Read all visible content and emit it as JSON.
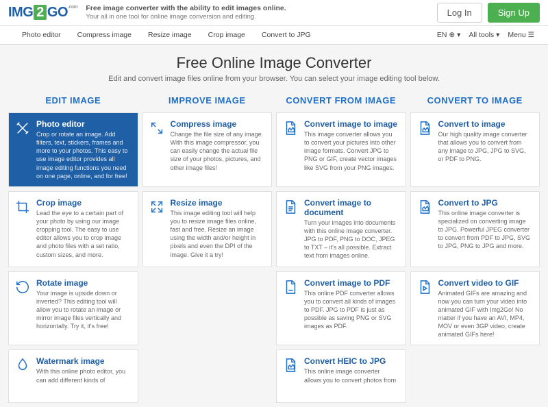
{
  "header": {
    "logo": {
      "img": "IMG",
      "two": "2",
      "go": "GO",
      "com": ".com"
    },
    "tagline_main": "Free image converter with the ability to edit images online.",
    "tagline_sub": "Your all in one tool for online image conversion and editing.",
    "login": "Log In",
    "signup": "Sign Up"
  },
  "nav": {
    "items": [
      "Photo editor",
      "Compress image",
      "Resize image",
      "Crop image",
      "Convert to JPG"
    ],
    "lang": "EN",
    "alltools": "All tools",
    "menu": "Menu"
  },
  "hero": {
    "title": "Free Online Image Converter",
    "subtitle": "Edit and convert image files online from your browser. You can select your image editing tool below."
  },
  "columns": [
    {
      "header": "EDIT IMAGE",
      "cards": [
        {
          "icon": "crossed-tools",
          "title": "Photo editor",
          "desc": "Crop or rotate an image. Add filters, text, stickers, frames and more to your photos. This easy to use image editor provides all image editing functions you need on one page, online, and for free!",
          "active": true
        },
        {
          "icon": "crop",
          "title": "Crop image",
          "desc": "Lead the eye to a certain part of your photo by using our image cropping tool. The easy to use editor allows you to crop image and photo files with a set ratio, custom sizes, and more."
        },
        {
          "icon": "rotate",
          "title": "Rotate image",
          "desc": "Your image is upside down or inverted? This editing tool will allow you to rotate an image or mirror image files vertically and horizontally. Try it, it's free!"
        },
        {
          "icon": "watermark",
          "title": "Watermark image",
          "desc": "With this online photo editor, you can add different kinds of"
        }
      ]
    },
    {
      "header": "IMPROVE IMAGE",
      "cards": [
        {
          "icon": "compress",
          "title": "Compress image",
          "desc": "Change the file size of any image. With this image compressor, you can easily change the actual file size of your photos, pictures, and other image files!"
        },
        {
          "icon": "resize",
          "title": "Resize image",
          "desc": "This image editing tool will help you to resize image files online, fast and free. Resize an image using the width and/or height in pixels and even the DPI of the image. Give it a try!"
        }
      ]
    },
    {
      "header": "CONVERT FROM IMAGE",
      "cards": [
        {
          "icon": "file-img",
          "title": "Convert image to image",
          "desc": "This image converter allows you to convert your pictures into other image formats. Convert JPG to PNG or GIF, create vector images like SVG from your PNG images."
        },
        {
          "icon": "file-doc",
          "title": "Convert image to document",
          "desc": "Turn your images into documents with this online image converter. JPG to PDF, PNG to DOC, JPEG to TXT – it's all possible. Extract text from images online."
        },
        {
          "icon": "file-pdf",
          "title": "Convert image to PDF",
          "desc": "This online PDF converter allows you to convert all kinds of images to PDF. JPG to PDF is just as possible as saving PNG or SVG images as PDF."
        },
        {
          "icon": "file-img",
          "title": "Convert HEIC to JPG",
          "desc": "This online image converter allows you to convert photos from"
        }
      ]
    },
    {
      "header": "CONVERT TO IMAGE",
      "cards": [
        {
          "icon": "file-img",
          "title": "Convert to image",
          "desc": "Our high quality image converter that allows you to convert from any image to JPG, JPG to SVG, or PDF to PNG."
        },
        {
          "icon": "file-img",
          "title": "Convert to JPG",
          "desc": "This online image converter is specialized on converting image to JPG. Powerful JPEG converter to convert from PDF to JPG, SVG to JPG, PNG to JPG and more."
        },
        {
          "icon": "file-video",
          "title": "Convert video to GIF",
          "desc": "Animated GIFs are amazing and now you can turn your video into animated GIF with Img2Go! No matter if you have an AVI, MP4, MOV or even 3GP video, create animated GIFs here!"
        }
      ]
    }
  ]
}
